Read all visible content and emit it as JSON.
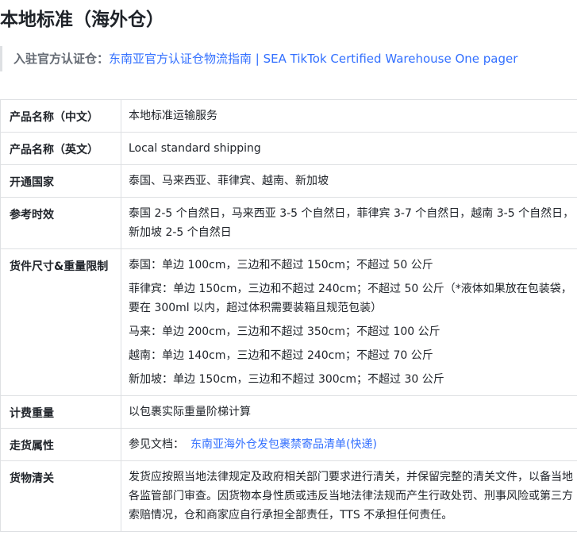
{
  "title": "本地标准（海外仓）",
  "callout": {
    "label": "入驻官方认证仓：",
    "link_text": "东南亚官方认证仓物流指南 | SEA TikTok Certified Warehouse One pager"
  },
  "table": {
    "rows": [
      {
        "label": "产品名称（中文）",
        "value": "本地标准运输服务"
      },
      {
        "label": "产品名称（英文）",
        "value": "Local standard shipping"
      },
      {
        "label": "开通国家",
        "value": "泰国、马来西亚、菲律宾、越南、新加坡"
      },
      {
        "label": "参考时效",
        "value": "泰国 2-5 个自然日，马来西亚 3-5 个自然日，菲律宾 3-7 个自然日，越南 3-5 个自然日，新加坡 2-5 个自然日"
      },
      {
        "label": "货件尺寸&重量限制",
        "lines": [
          "泰国：单边 100cm，三边和不超过 150cm；不超过 50 公斤",
          "菲律宾：单边 150cm，三边和不超过 240cm；不超过 50 公斤（*液体如果放在包装袋，要在 300ml 以内，超过体积需要装箱且规范包装）",
          "马来：单边 200cm，三边和不超过 350cm；不超过 100 公斤",
          "越南：单边 140cm，三边和不超过 240cm；不超过 70 公斤",
          "新加坡：单边 150cm，三边和不超过 300cm；不超过 30 公斤"
        ]
      },
      {
        "label": "计费重量",
        "value": "以包裹实际重量阶梯计算"
      },
      {
        "label": "走货属性",
        "value_prefix": "参见文档：",
        "link_text": "东南亚海外仓发包裹禁寄品清单(快递)"
      },
      {
        "label": "货物清关",
        "value": "发货应按照当地法律规定及政府相关部门要求进行清关，并保留完整的清关文件，以备当地各监管部门审查。因货物本身性质或违反当地法律法规而产生行政处罚、刑事风险或第三方索赔情况，仓和商家应自行承担全部责任，TTS 不承担任何责任。"
      }
    ]
  }
}
